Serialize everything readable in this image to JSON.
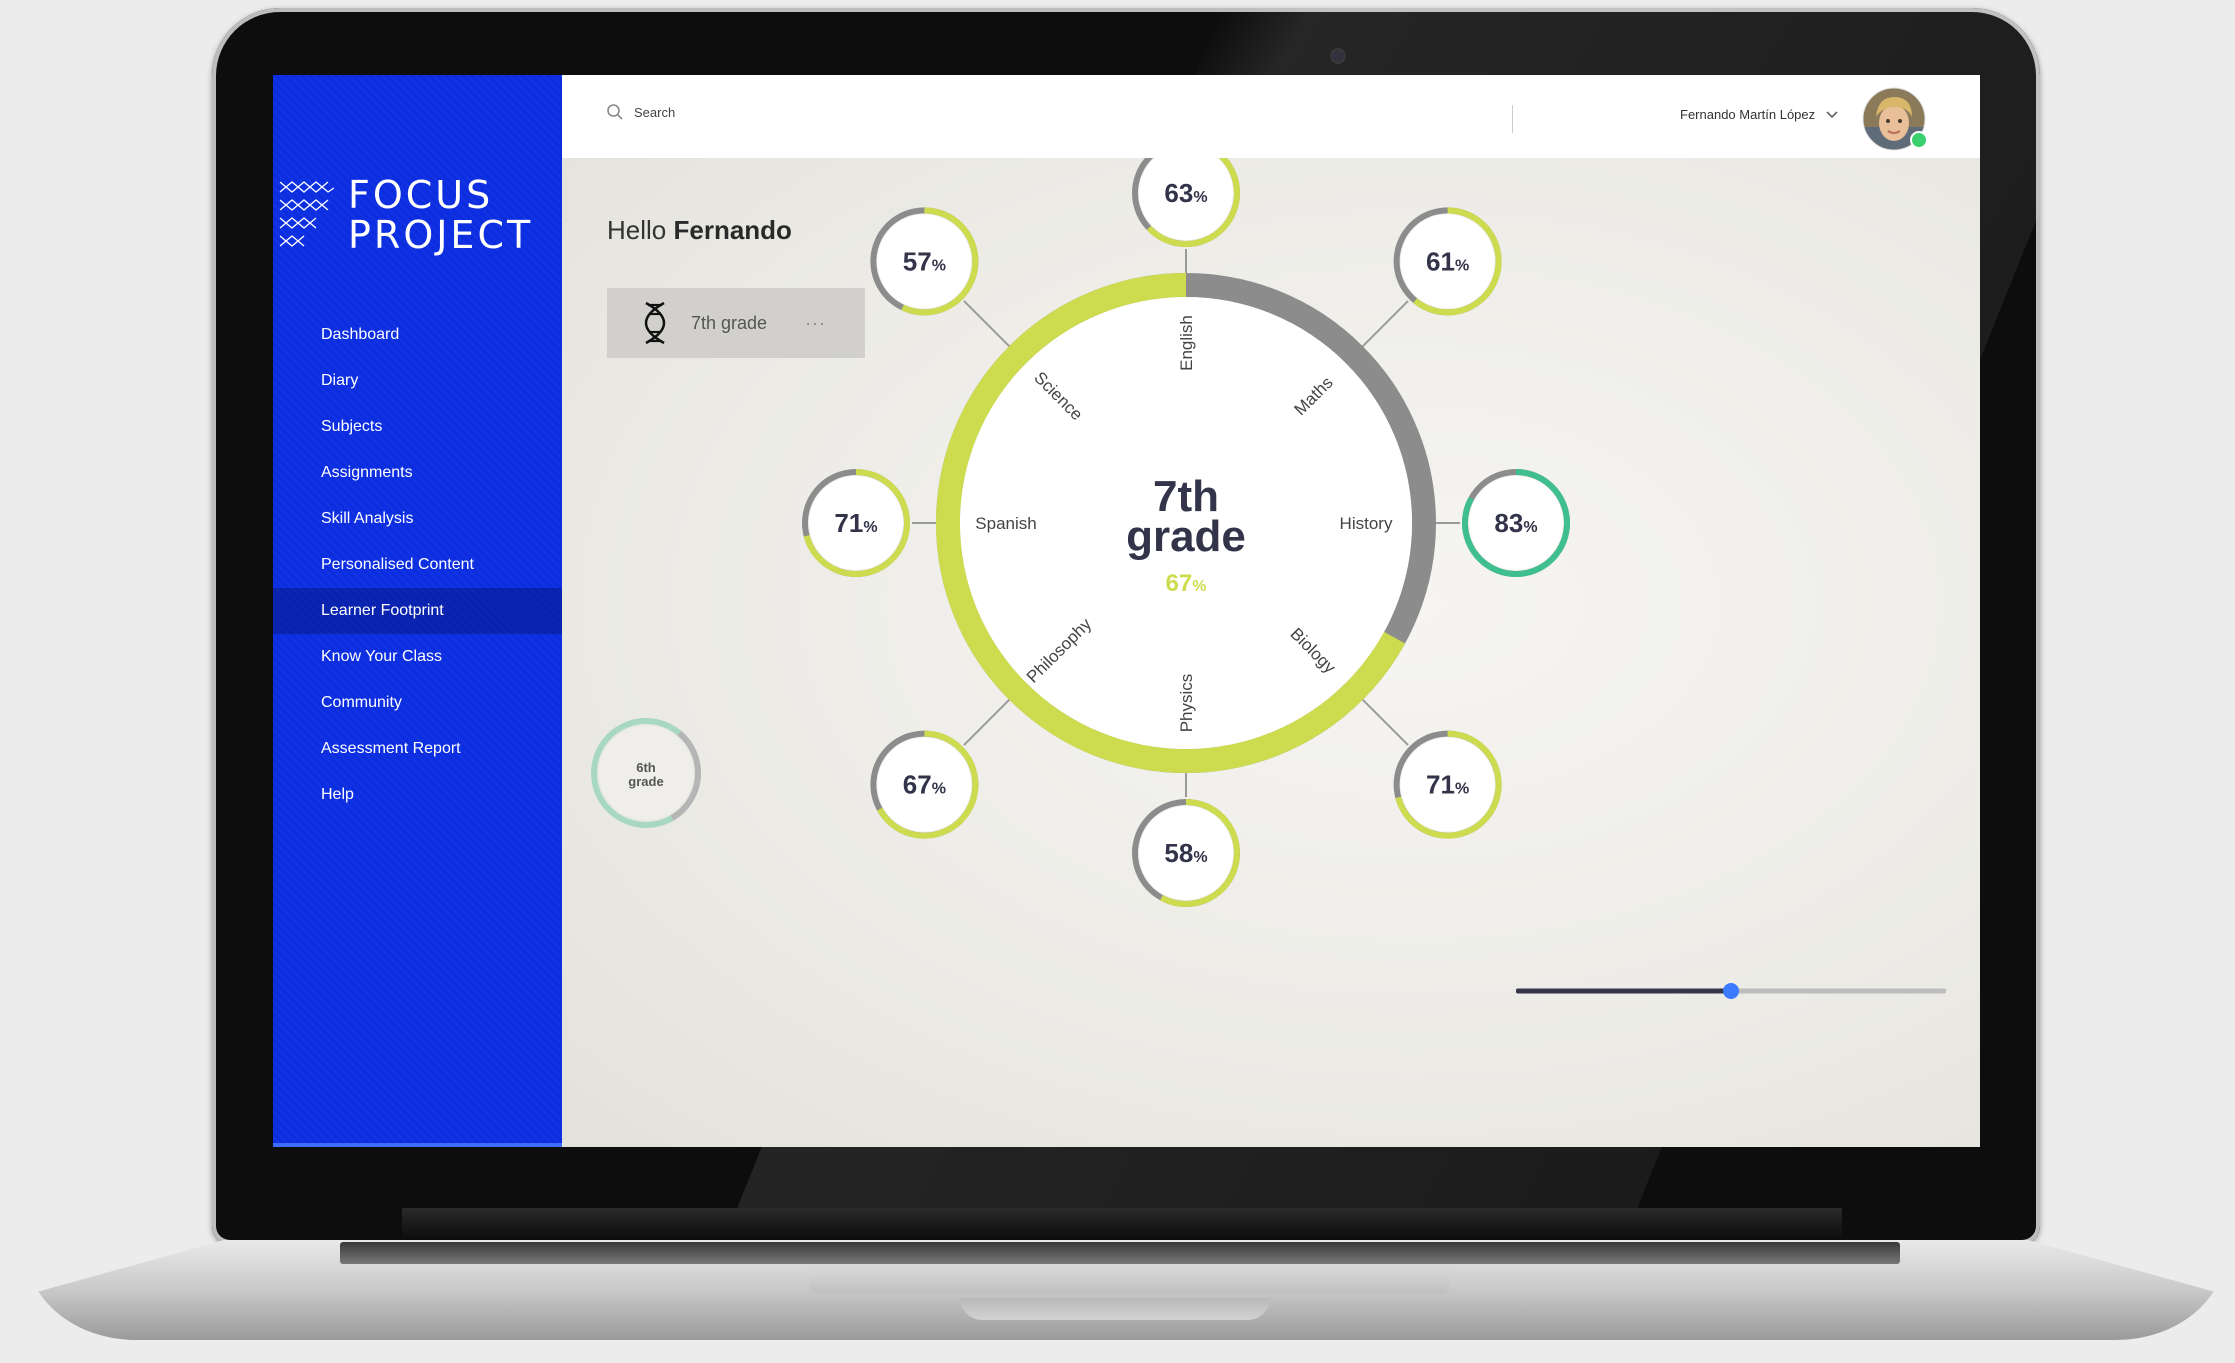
{
  "brand": {
    "line1": "FOCUS",
    "line2": "PROJECT"
  },
  "colors": {
    "sidebar": "#0c2ee0",
    "accent": "#cddc4f",
    "track": "#8c8c8c",
    "highlight": "#3fbf8f",
    "slider": "#3a7bff"
  },
  "nav": {
    "items": [
      {
        "label": "Dashboard"
      },
      {
        "label": "Diary"
      },
      {
        "label": "Subjects"
      },
      {
        "label": "Assignments"
      },
      {
        "label": "Skill Analysis"
      },
      {
        "label": "Personalised Content"
      },
      {
        "label": "Learner Footprint",
        "active": true
      },
      {
        "label": "Know Your Class"
      },
      {
        "label": "Community"
      },
      {
        "label": "Assessment Report"
      },
      {
        "label": "Help"
      }
    ]
  },
  "topbar": {
    "search_placeholder": "Search",
    "user_name": "Fernando Martín López",
    "search_icon": "search-icon",
    "dropdown_icon": "chevron-down-icon"
  },
  "main": {
    "greeting_prefix": "Hello",
    "greeting_name": "Fernando",
    "grade_card": {
      "label": "7th grade",
      "more": "···",
      "icon": "dna-icon"
    },
    "center": {
      "line1": "7th",
      "line2": "grade",
      "percent": "67",
      "percent_sign": "%",
      "progress": 0.67
    },
    "subjects": [
      {
        "name": "English",
        "value": 63
      },
      {
        "name": "Maths",
        "value": 61
      },
      {
        "name": "History",
        "value": 83,
        "highlight": true
      },
      {
        "name": "Biology",
        "value": 71
      },
      {
        "name": "Physics",
        "value": 58
      },
      {
        "name": "Philosophy",
        "value": 67
      },
      {
        "name": "Spanish",
        "value": 71
      },
      {
        "name": "Science",
        "value": 57
      }
    ],
    "percent_sign": "%",
    "previous_grade": {
      "line1": "6th",
      "line2": "grade"
    },
    "timeline_slider": {
      "value": 0.5
    }
  }
}
